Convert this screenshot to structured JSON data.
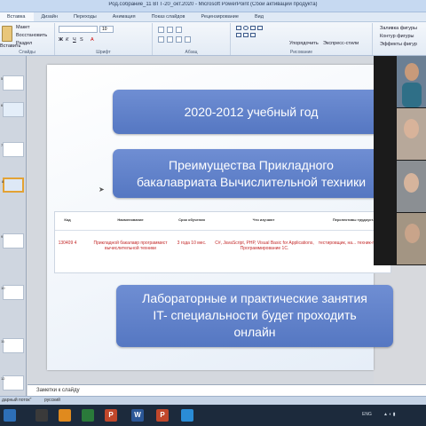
{
  "window": {
    "title": "Род.собрание_11 ВТТ-20_окт.2020  -  Microsoft PowerPoint (Сбой активации продукта)"
  },
  "tabs": [
    "Вставка",
    "Дизайн",
    "Переходы",
    "Анимация",
    "Показ слайдов",
    "Рецензирование",
    "Вид"
  ],
  "ribbon": {
    "paste_label": "Вставить",
    "layout_label": "Макет",
    "restore_label": "Восстановить",
    "section_label": "Раздел",
    "font_size": "10",
    "arrange_label": "Упорядочить",
    "quick_styles_label": "Экспресс-стили",
    "fill_label": "Заливка фигуры",
    "outline_label": "Контур фигуры",
    "effects_label": "Эффекты фигур",
    "groups": {
      "slides": "Слайды",
      "font": "Шрифт",
      "paragraph": "Абзац",
      "drawing": "Рисование"
    }
  },
  "thumbnails": [
    "5",
    "6",
    "7",
    "8",
    "9",
    "10",
    "11",
    "12"
  ],
  "slide": {
    "box1": "2020-2012    учебный год",
    "box2_line1": "Преимущества Прикладного",
    "box2_line2": "бакалавриата Вычислительной техники",
    "box3_line1": "Лабораторные и практические занятия",
    "box3_line2": "IT- специальности будет проходить",
    "box3_line3": "онлайн",
    "table": {
      "headers": [
        "Код",
        "Наименование",
        "Срок обучения",
        "Что изучают",
        "Перспективы трудоуст."
      ],
      "row": {
        "code": "130409 4",
        "name": "Прикладной бакалавр программист вычислительной техники",
        "term": "3 года 10 мес.",
        "subjects": "C#, JavaScript, PHP, Visual Basic for Applications, Программирование 1С.",
        "prospects": "тестировщик, на... техник-програ..."
      }
    }
  },
  "notes": {
    "placeholder": "Заметки к слайду"
  },
  "status": {
    "theme": "дарный поток\"",
    "language": "русский"
  },
  "taskbar": {
    "apps": [
      "P",
      "W",
      "P"
    ],
    "tray_text": "ENG"
  }
}
